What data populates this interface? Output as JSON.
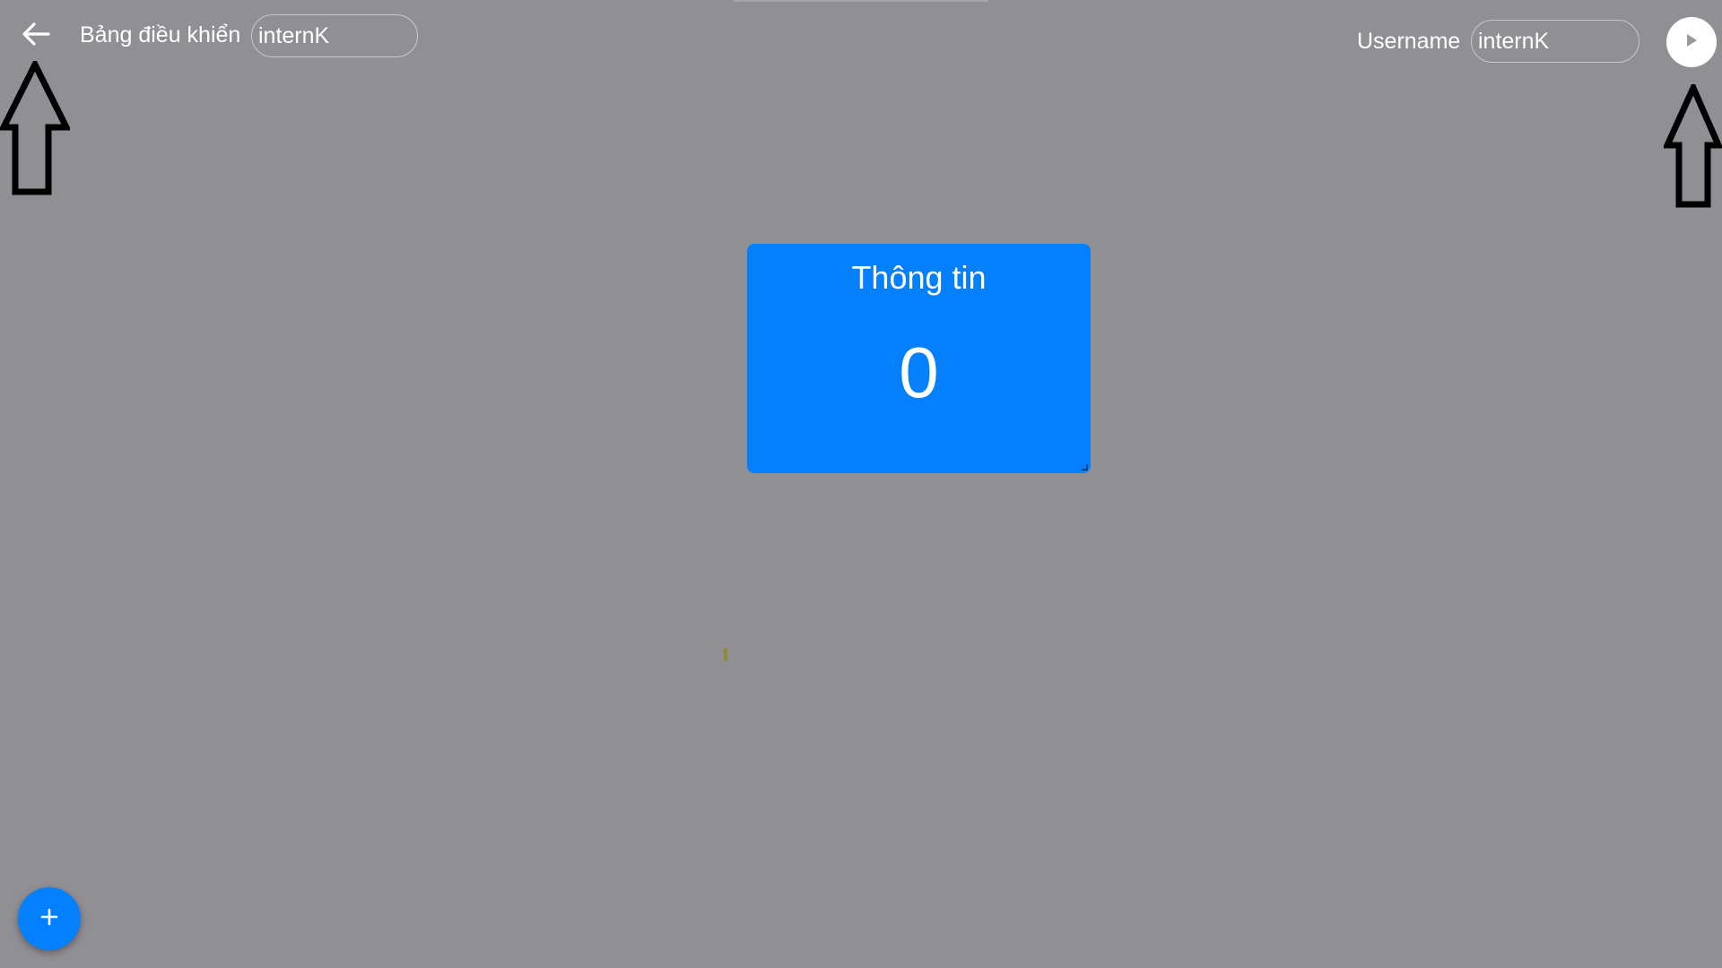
{
  "header": {
    "back_icon": "arrow-left-icon",
    "dashboard_title": "Bảng điều khiển",
    "dashboard_input_value": "internK",
    "username_label": "Username",
    "username_input_value": "internK",
    "play_icon": "play-icon"
  },
  "card": {
    "title": "Thông tin",
    "value": "0",
    "color": "#0580fd"
  },
  "fab": {
    "icon": "plus-icon",
    "color": "#0580fd"
  },
  "annotations": {
    "icon": "up-arrow-outline-icon",
    "count": 2
  },
  "colors": {
    "background": "#908f94",
    "accent": "#0580fd",
    "text": "#ffffff"
  }
}
